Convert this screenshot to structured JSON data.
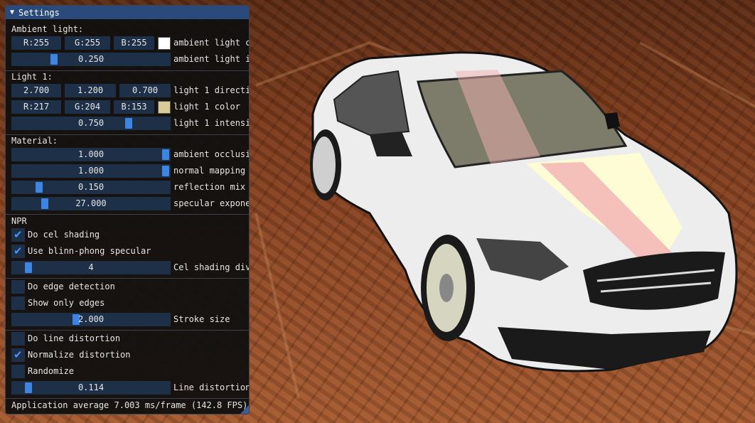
{
  "window": {
    "title": "Settings"
  },
  "ambient": {
    "header": "Ambient light:",
    "r": "R:255",
    "g": "G:255",
    "b": "B:255",
    "color_label": "ambient light c",
    "swatch": "#ffffff",
    "intensity_value": "0.250",
    "intensity_fraction": 0.25,
    "intensity_label": "ambient light i"
  },
  "light1": {
    "header": "Light 1:",
    "dir_x": "2.700",
    "dir_y": "1.200",
    "dir_z": "0.700",
    "dir_label": "light 1 directi",
    "r": "R:217",
    "g": "G:204",
    "b": "B:153",
    "color_label": "light 1 color",
    "swatch": "#d9cc99",
    "intensity_value": "0.750",
    "intensity_fraction": 0.75,
    "intensity_label": "light 1 intensi"
  },
  "material": {
    "header": "Material:",
    "ao_value": "1.000",
    "ao_fraction": 1.0,
    "ao_label": "ambient occlusi",
    "normal_value": "1.000",
    "normal_fraction": 1.0,
    "normal_label": "normal mapping",
    "refl_value": "0.150",
    "refl_fraction": 0.15,
    "refl_label": "reflection mix",
    "spec_value": "27.000",
    "spec_fraction": 0.19,
    "spec_label": "specular expone"
  },
  "npr": {
    "header": "NPR",
    "cel_label": "Do cel shading",
    "cel_checked": true,
    "blinn_label": "Use blinn-phong specular",
    "blinn_checked": true,
    "cel_div_value": "4",
    "cel_div_fraction": 0.08,
    "cel_div_label": "Cel shading div"
  },
  "edges": {
    "edge_label": "Do edge detection",
    "edge_checked": false,
    "only_label": "Show only edges",
    "only_checked": false,
    "stroke_value": "2.000",
    "stroke_fraction": 0.4,
    "stroke_label": "Stroke size"
  },
  "distortion": {
    "line_label": "Do line distortion",
    "line_checked": false,
    "norm_label": "Normalize distortion",
    "norm_checked": true,
    "rand_label": "Randomize",
    "rand_checked": false,
    "amount_value": "0.114",
    "amount_fraction": 0.08,
    "amount_label": "Line distortion"
  },
  "status": "Application average 7.003 ms/frame (142.8 FPS)",
  "colors": {
    "title_bar": "#294a7a",
    "frame_bg": "#1d3048",
    "grab": "#3d85e0",
    "check": "#4a90ff"
  }
}
